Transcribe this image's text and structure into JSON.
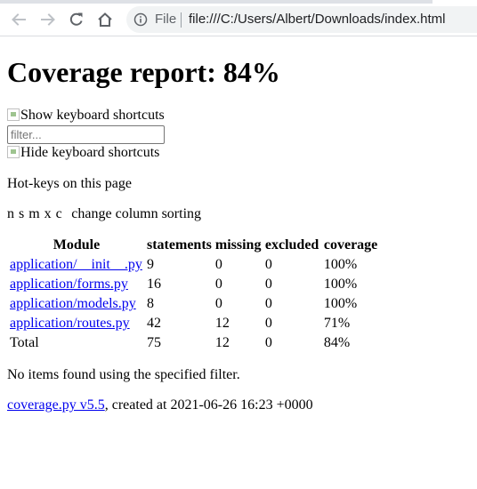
{
  "browser": {
    "security_label": "File",
    "url": "file:///C:/Users/Albert/Downloads/index.html",
    "icons": [
      "back-arrow-icon",
      "forward-arrow-icon",
      "reload-icon",
      "home-icon",
      "info-icon"
    ]
  },
  "page": {
    "title": "Coverage report: 84%",
    "show_shortcuts_alt": "Show keyboard shortcuts",
    "filter_placeholder": "filter...",
    "filter_value": "",
    "hide_shortcuts_alt": "Hide keyboard shortcuts",
    "hotkeys_title": "Hot-keys on this page",
    "hotkeys_keys": "n s m x c",
    "hotkeys_desc": "change column sorting",
    "status": "No items found using the specified filter.",
    "footer": {
      "link_text": "coverage.py v5.5",
      "suffix": ", created at 2021-06-26 16:23 +0000"
    }
  },
  "table": {
    "headers": [
      "Module",
      "statements",
      "missing",
      "excluded",
      "coverage"
    ],
    "rows": [
      {
        "module": "application/__init__.py",
        "statements": "9",
        "missing": "0",
        "excluded": "0",
        "coverage": "100%"
      },
      {
        "module": "application/forms.py",
        "statements": "16",
        "missing": "0",
        "excluded": "0",
        "coverage": "100%"
      },
      {
        "module": "application/models.py",
        "statements": "8",
        "missing": "0",
        "excluded": "0",
        "coverage": "100%"
      },
      {
        "module": "application/routes.py",
        "statements": "42",
        "missing": "12",
        "excluded": "0",
        "coverage": "71%"
      }
    ],
    "total": {
      "module": "Total",
      "statements": "75",
      "missing": "12",
      "excluded": "0",
      "coverage": "84%"
    }
  },
  "colors": {
    "link": "#0000ee",
    "omnibox_bg": "#f1f3f4",
    "icon": "#5f6368"
  }
}
